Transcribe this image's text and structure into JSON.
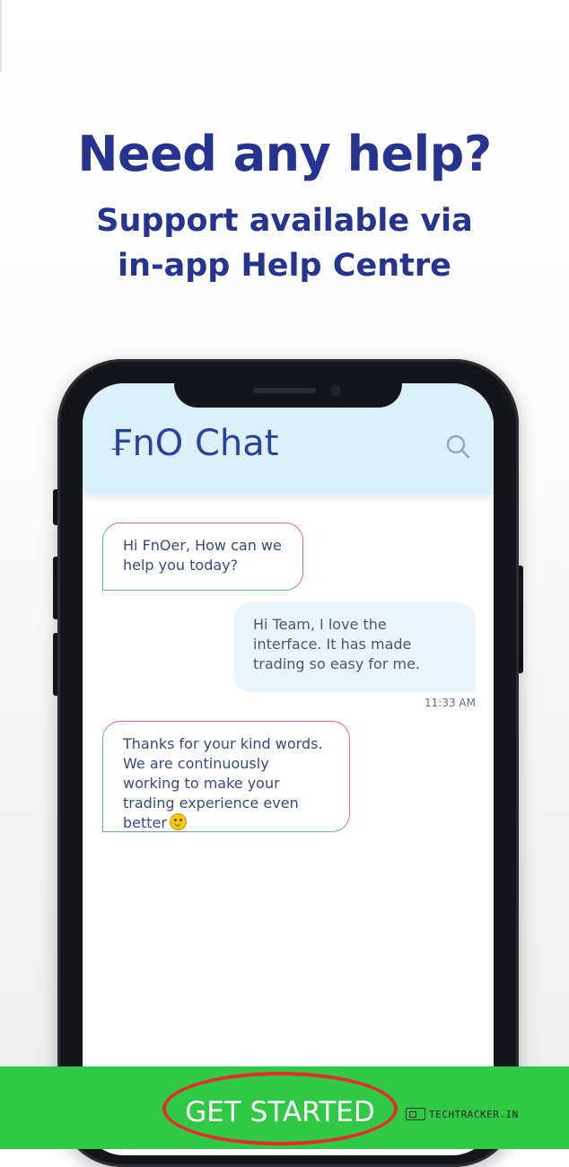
{
  "promo": {
    "headline": "Need any help?",
    "subline1": "Support available via",
    "subline2": "in-app Help Centre"
  },
  "chat": {
    "title": "₣nO Chat",
    "search_icon": "search-icon",
    "messages": [
      {
        "from": "support",
        "text": "Hi FnOer, How can we help you today?"
      },
      {
        "from": "user",
        "text": "Hi Team, I love the interface. It has made trading so easy for me.",
        "time": "11:33 AM"
      },
      {
        "from": "support",
        "text": "Thanks for your kind words. We are continuously working to make your trading experience even better",
        "emoji": "smile-emoji"
      }
    ]
  },
  "cta": {
    "label": "GET STARTED"
  },
  "watermark": {
    "text": "TECHTRACKER.IN"
  },
  "colors": {
    "primary_text": "#24348f",
    "header_bg": "#dcf0fa",
    "cta_bg": "#2fc946",
    "highlight_ring": "#e62d2d"
  }
}
